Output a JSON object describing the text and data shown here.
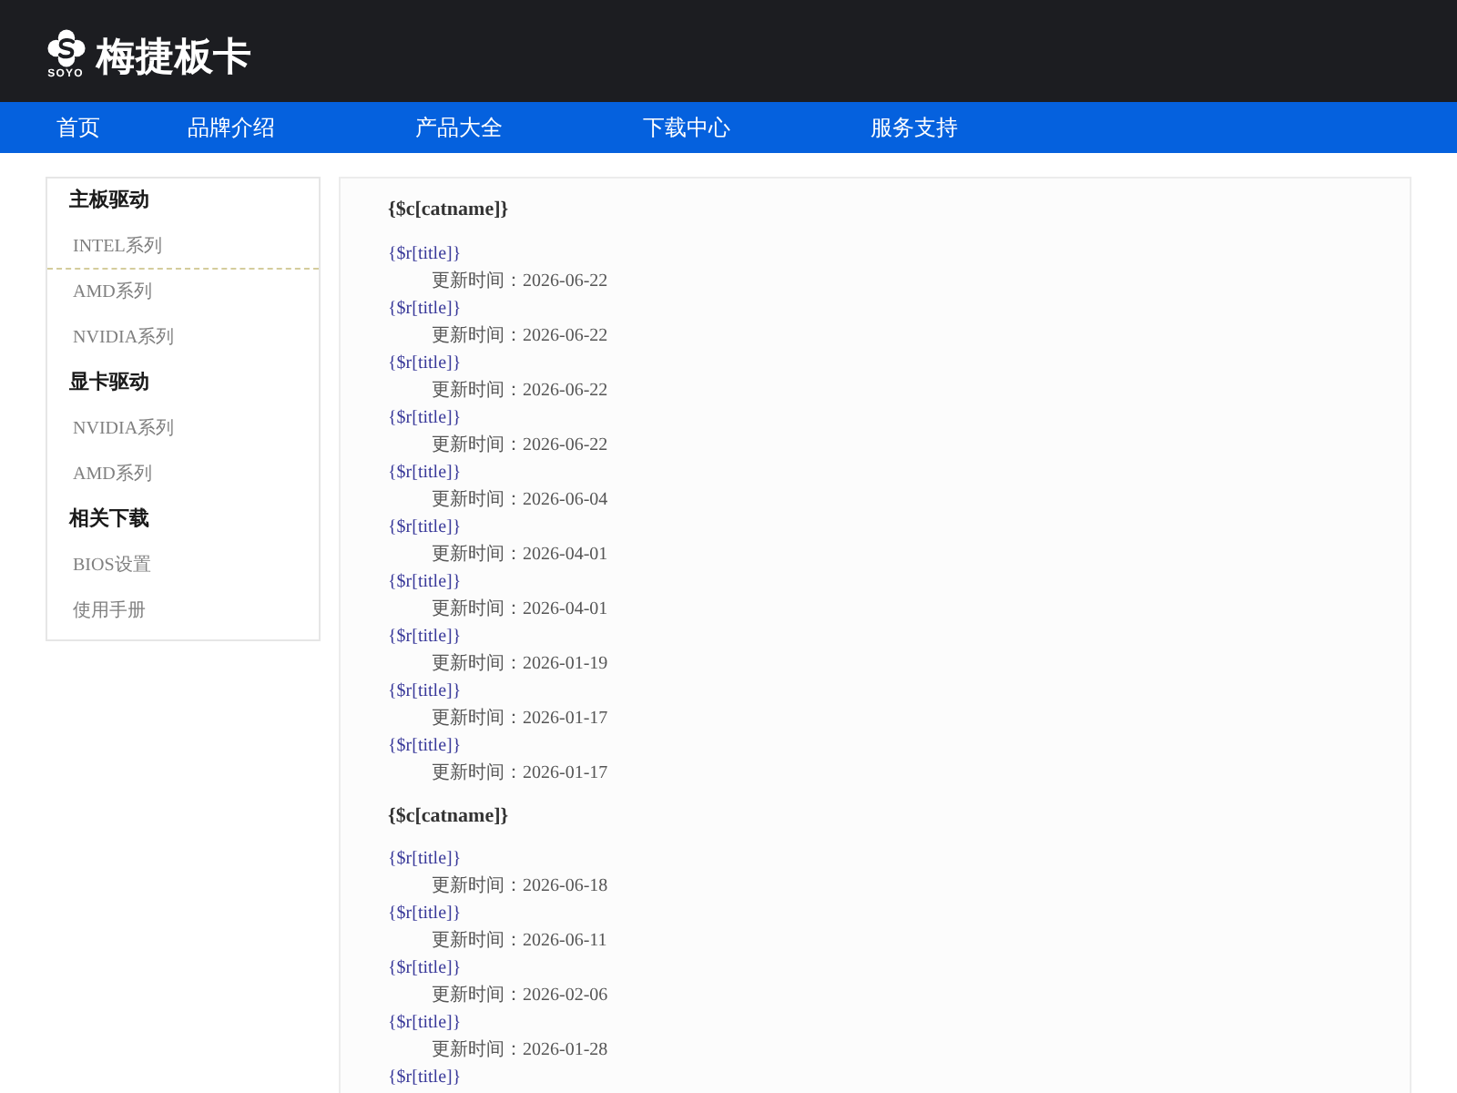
{
  "header": {
    "logo": {
      "mark_text": "SOYO",
      "title": "梅捷板卡"
    }
  },
  "nav": [
    {
      "label": "首页"
    },
    {
      "label": "品牌介绍"
    },
    {
      "label": "产品大全"
    },
    {
      "label": "下载中心"
    },
    {
      "label": "服务支持"
    }
  ],
  "sidebar": {
    "sections": [
      {
        "heading": "主板驱动",
        "items": [
          {
            "label": "INTEL系列",
            "selected": true
          },
          {
            "label": "AMD系列",
            "selected": false
          },
          {
            "label": "NVIDIA系列",
            "selected": false
          }
        ]
      },
      {
        "heading": "显卡驱动",
        "items": [
          {
            "label": "NVIDIA系列",
            "selected": false
          },
          {
            "label": "AMD系列",
            "selected": false
          }
        ]
      },
      {
        "heading": "相关下载",
        "items": [
          {
            "label": "BIOS设置",
            "selected": false
          },
          {
            "label": "使用手册",
            "selected": false
          }
        ]
      }
    ]
  },
  "main": {
    "groups": [
      {
        "heading": "{$c[catname]}",
        "items": [
          {
            "title": "{$r[title]}",
            "updated": "更新时间：2026-06-22"
          },
          {
            "title": "{$r[title]}",
            "updated": "更新时间：2026-06-22"
          },
          {
            "title": "{$r[title]}",
            "updated": "更新时间：2026-06-22"
          },
          {
            "title": "{$r[title]}",
            "updated": "更新时间：2026-06-22"
          },
          {
            "title": "{$r[title]}",
            "updated": "更新时间：2026-06-04"
          },
          {
            "title": "{$r[title]}",
            "updated": "更新时间：2026-04-01"
          },
          {
            "title": "{$r[title]}",
            "updated": "更新时间：2026-04-01"
          },
          {
            "title": "{$r[title]}",
            "updated": "更新时间：2026-01-19"
          },
          {
            "title": "{$r[title]}",
            "updated": "更新时间：2026-01-17"
          },
          {
            "title": "{$r[title]}",
            "updated": "更新时间：2026-01-17"
          }
        ]
      },
      {
        "heading": "{$c[catname]}",
        "items": [
          {
            "title": "{$r[title]}",
            "updated": "更新时间：2026-06-18"
          },
          {
            "title": "{$r[title]}",
            "updated": "更新时间：2026-06-11"
          },
          {
            "title": "{$r[title]}",
            "updated": "更新时间：2026-02-06"
          },
          {
            "title": "{$r[title]}",
            "updated": "更新时间：2026-01-28"
          },
          {
            "title": "{$r[title]}"
          }
        ]
      }
    ]
  }
}
